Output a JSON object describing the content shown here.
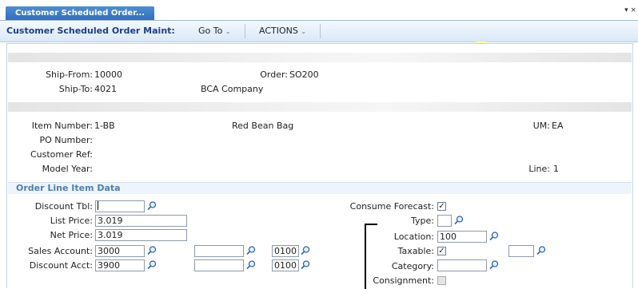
{
  "tab": {
    "label": "Customer Scheduled Order..."
  },
  "window_controls": "▾ ×",
  "toolbar": {
    "title": "Customer Scheduled Order Maint:",
    "goto_label": "Go To",
    "actions_label": "ACTIONS"
  },
  "header": {
    "ship_from_label": "Ship-From:",
    "ship_from_value": "10000",
    "order_label": "Order:",
    "order_value": "SO200",
    "ship_to_label": "Ship-To:",
    "ship_to_value": "4021",
    "ship_to_name": "BCA Company"
  },
  "item": {
    "item_number_label": "Item Number:",
    "item_number_value": "1-BB",
    "item_desc": "Red Bean Bag",
    "um_label": "UM:",
    "um_value": "EA",
    "po_number_label": "PO Number:",
    "customer_ref_label": "Customer Ref:",
    "model_year_label": "Model Year:",
    "line_label": "Line:",
    "line_value": "1"
  },
  "section": {
    "title": "Order Line Item Data"
  },
  "form": {
    "discount_tbl_label": "Discount Tbl:",
    "discount_tbl_value": "",
    "list_price_label": "List Price:",
    "list_price_value": "3.019",
    "net_price_label": "Net Price:",
    "net_price_value": "3.019",
    "sales_account_label": "Sales Account:",
    "sales_account_value": "3000",
    "sales_sub_value": "",
    "sales_cc_value": "0100",
    "discount_acct_label": "Discount Acct:",
    "discount_acct_value": "3900",
    "discount_sub_value": "",
    "discount_cc_value": "0100",
    "consume_forecast_label": "Consume Forecast:",
    "consume_forecast_checked": true,
    "type_label": "Type:",
    "type_value": "",
    "location_label": "Location:",
    "location_value": "100",
    "taxable_label": "Taxable:",
    "taxable_checked": true,
    "tax_usage_value": "",
    "category_label": "Category:",
    "category_value": "",
    "consignment_label": "Consignment:",
    "consignment_checked": false
  }
}
